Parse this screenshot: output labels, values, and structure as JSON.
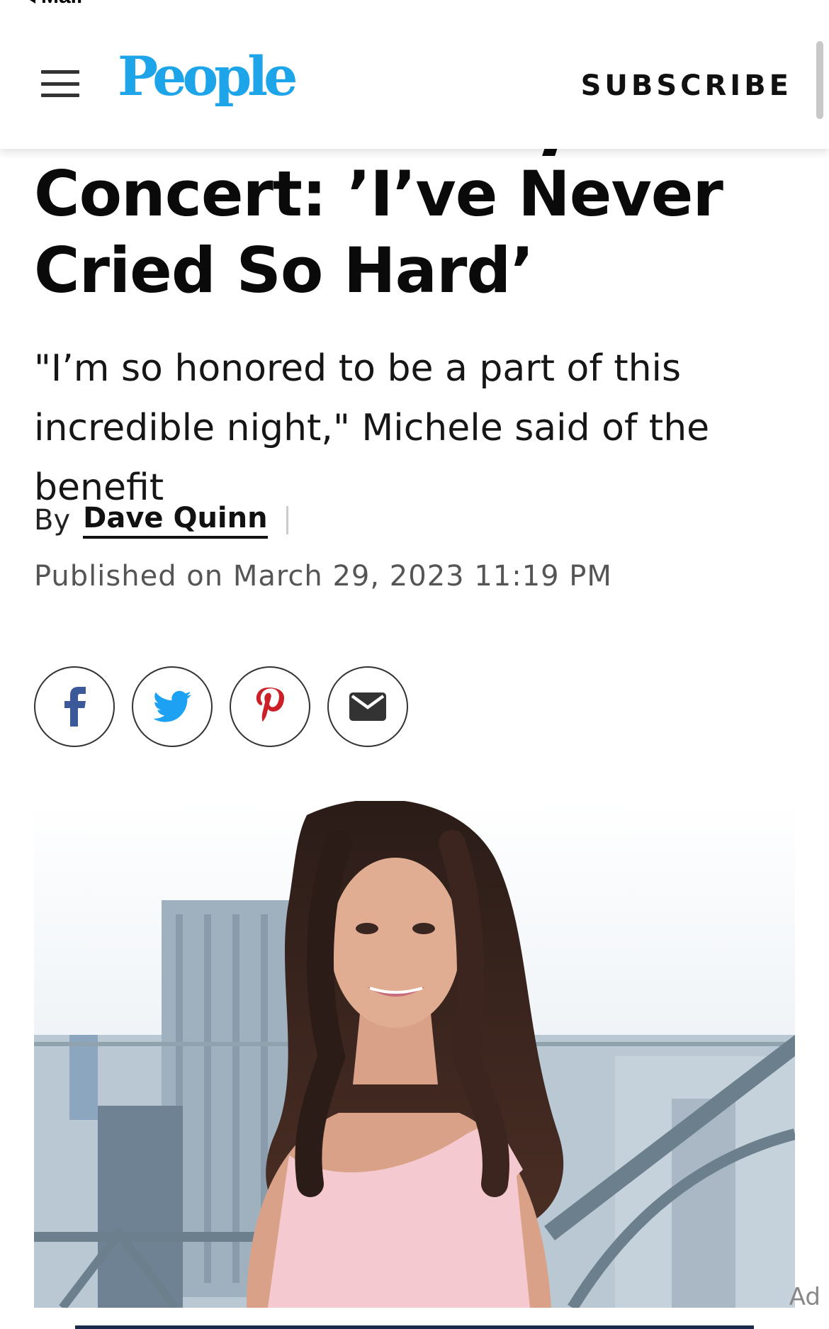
{
  "status_bar": {
    "back_label": "Mail"
  },
  "header": {
    "logo_text": "People",
    "subscribe_label": "SUBSCRIBE",
    "brand_color": "#1ea4e8"
  },
  "article": {
    "headline": "Concert: ’I’ve Never Cried So Hard’",
    "dek": "\"I’m so honored to be a part of this incredible night,\" Michele said of the benefit",
    "byline_prefix": "By",
    "author": "Dave Quinn",
    "published": "Published on March 29, 2023 11:19 PM"
  },
  "share": [
    {
      "name": "facebook",
      "icon": "facebook-icon",
      "color": "#3b5998"
    },
    {
      "name": "twitter",
      "icon": "twitter-icon",
      "color": "#1da1f2"
    },
    {
      "name": "pinterest",
      "icon": "pinterest-icon",
      "color": "#cb2027"
    },
    {
      "name": "email",
      "icon": "email-icon",
      "color": "#333333"
    }
  ],
  "ad_label": "Ad"
}
